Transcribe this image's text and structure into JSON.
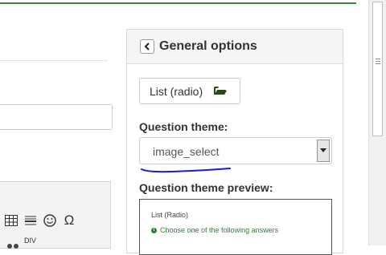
{
  "panel": {
    "title": "General options",
    "question_type_button": "List (radio)",
    "theme_label": "Question theme:",
    "theme_value": "image_select",
    "preview_label": "Question theme preview:"
  },
  "preview": {
    "question_type": "List (Radio)",
    "hint": "Choose one of the following answers"
  },
  "editor": {
    "div_label": "DIV",
    "tools": [
      "table-icon",
      "horizontal-rule-icon",
      "smiley-icon",
      "omega-icon"
    ]
  },
  "colors": {
    "accent_green": "#328637",
    "hint_green": "#2e7d32",
    "annotation_blue": "#1a1adb"
  }
}
